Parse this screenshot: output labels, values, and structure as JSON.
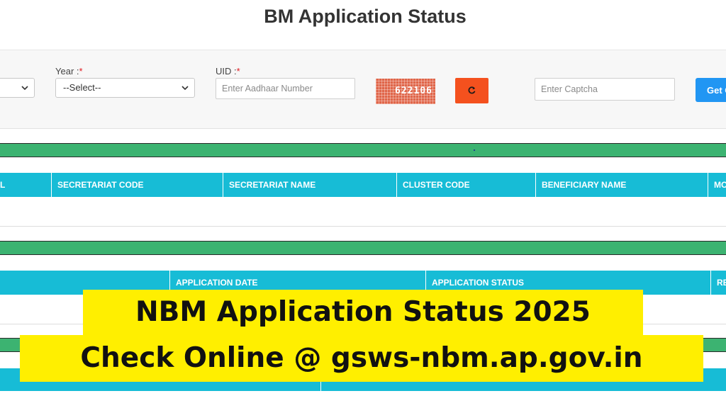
{
  "page_title": "BM Application Status",
  "form": {
    "first_select_value": "",
    "year": {
      "label": "Year :",
      "required_mark": "*",
      "selected": "--Select--"
    },
    "uid": {
      "label": "UID :",
      "required_mark": "*",
      "placeholder": "Enter Aadhaar Number"
    },
    "captcha": {
      "code": "622106",
      "input_placeholder": "Enter Captcha"
    },
    "submit_label": "Get C",
    "colors": {
      "refresh_button": "#f4511e",
      "submit_button": "#2196f3"
    }
  },
  "table_1": {
    "columns": [
      "L",
      "SECRETARIAT CODE",
      "SECRETARIAT NAME",
      "CLUSTER CODE",
      "BENEFICIARY NAME",
      "MO"
    ]
  },
  "table_2": {
    "columns": [
      "",
      "APPLICATION DATE",
      "APPLICATION STATUS",
      "RE"
    ]
  },
  "banner": {
    "line1": "NBM Application Status 2025",
    "line2": "Check Online @ gsws-nbm.ap.gov.in"
  },
  "colors": {
    "section_bar": "#3cb371",
    "table_header": "#17bcd6",
    "banner_bg": "#ffef00",
    "captcha_bg": "#e0664a"
  }
}
